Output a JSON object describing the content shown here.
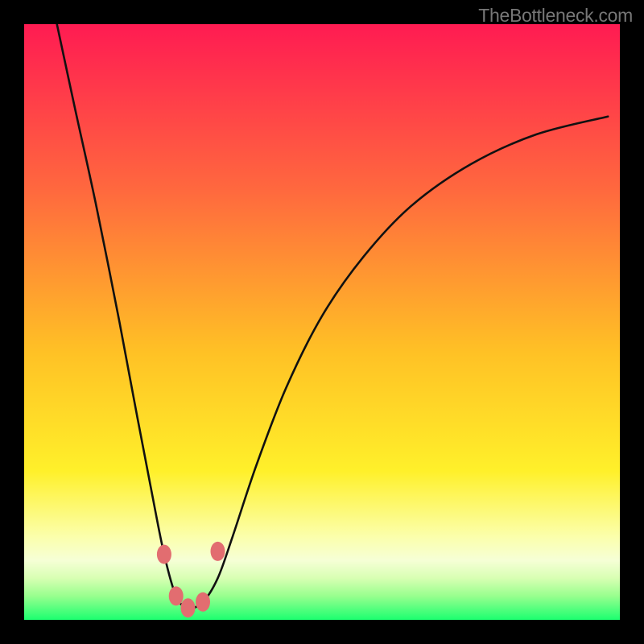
{
  "watermark": "TheBottleneck.com",
  "colors": {
    "top": "#ff1b52",
    "mid_upper": "#ff7a3a",
    "mid": "#ffc725",
    "mid_lower": "#fff02a",
    "pale": "#fdffc0",
    "bottom": "#20ff73",
    "curve": "#111111",
    "marker": "#e26d70",
    "frame": "#000000"
  },
  "chart_data": {
    "type": "line",
    "title": "",
    "xlabel": "",
    "ylabel": "",
    "xlim": [
      0,
      1
    ],
    "ylim": [
      0,
      1
    ],
    "note": "x and y are normalized to the 740x740 plotting area. y=0 is bottom, y=1 is top. The curve is a V-shaped bottleneck profile with minimum near x≈0.27.",
    "series": [
      {
        "name": "bottleneck-curve",
        "x": [
          0.055,
          0.085,
          0.12,
          0.16,
          0.19,
          0.215,
          0.235,
          0.255,
          0.275,
          0.3,
          0.325,
          0.35,
          0.39,
          0.44,
          0.5,
          0.57,
          0.65,
          0.75,
          0.86,
          0.98
        ],
        "y": [
          1.0,
          0.86,
          0.7,
          0.5,
          0.34,
          0.21,
          0.11,
          0.04,
          0.02,
          0.03,
          0.07,
          0.14,
          0.26,
          0.39,
          0.51,
          0.61,
          0.695,
          0.765,
          0.815,
          0.845
        ]
      }
    ],
    "markers": {
      "name": "highlight-points",
      "x": [
        0.235,
        0.255,
        0.275,
        0.3,
        0.325
      ],
      "y": [
        0.11,
        0.04,
        0.02,
        0.03,
        0.115
      ]
    }
  }
}
